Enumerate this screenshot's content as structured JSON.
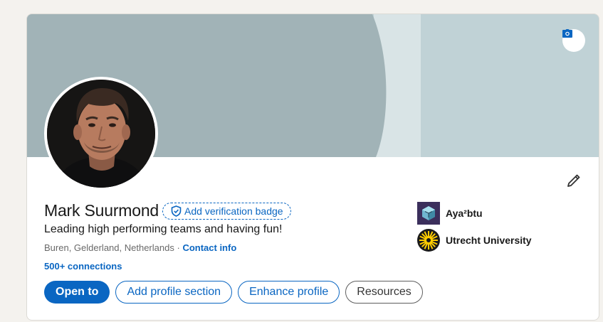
{
  "profile": {
    "name": "Mark Suurmond",
    "verification_label": "Add verification badge",
    "headline": "Leading high performing teams and having fun!",
    "location": "Buren, Gelderland, Netherlands",
    "separator": "·",
    "contact_label": "Contact info",
    "connections_label": "500+ connections"
  },
  "actions": {
    "open_to": "Open to",
    "add_section": "Add profile section",
    "enhance": "Enhance profile",
    "resources": "Resources"
  },
  "organizations": [
    {
      "name": "Aya²btu",
      "logo": "cube-logo-icon"
    },
    {
      "name": "Utrecht University",
      "logo": "university-sun-logo-icon"
    }
  ],
  "icons": {
    "camera": "camera-icon",
    "edit": "pencil-icon",
    "verify": "shield-check-icon"
  },
  "colors": {
    "brand_blue": "#0a66c2",
    "banner": "#c0d2d6",
    "page_bg": "#f4f2ee"
  }
}
